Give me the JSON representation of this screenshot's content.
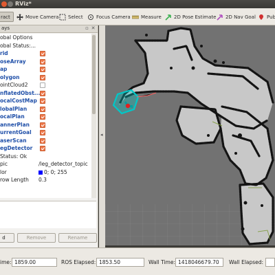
{
  "window": {
    "title": "RViz*"
  },
  "toolbar": {
    "interact": "ract",
    "move_camera": "Move Camera",
    "select": "Select",
    "focus_camera": "Focus Camera",
    "measure": "Measure",
    "pose_estimate": "2D Pose Estimate",
    "nav_goal": "2D Nav Goal",
    "publish": "Pub"
  },
  "displays": {
    "header": "ays",
    "items": [
      {
        "label": "obal Options",
        "style": "normal",
        "checked": null,
        "value": ""
      },
      {
        "label": "obal Status:...",
        "style": "normal",
        "checked": null,
        "value": ""
      },
      {
        "label": "rid",
        "style": "blue",
        "checked": true,
        "value": ""
      },
      {
        "label": "oseArray",
        "style": "blue",
        "checked": true,
        "value": ""
      },
      {
        "label": "ap",
        "style": "blue",
        "checked": true,
        "value": ""
      },
      {
        "label": "olygon",
        "style": "blue",
        "checked": true,
        "value": ""
      },
      {
        "label": "ointCloud2",
        "style": "normal",
        "checked": false,
        "value": ""
      },
      {
        "label": "nflatedObst...",
        "style": "blue",
        "checked": true,
        "value": ""
      },
      {
        "label": "ocalCostMap",
        "style": "blue",
        "checked": true,
        "value": ""
      },
      {
        "label": "lobalPlan",
        "style": "blue",
        "checked": true,
        "value": ""
      },
      {
        "label": "ocalPlan",
        "style": "blue",
        "checked": true,
        "value": ""
      },
      {
        "label": "annerPlan",
        "style": "blue",
        "checked": true,
        "value": ""
      },
      {
        "label": "urrentGoal",
        "style": "blue",
        "checked": true,
        "value": ""
      },
      {
        "label": "aserScan",
        "style": "blue",
        "checked": true,
        "value": ""
      },
      {
        "label": "egDetector",
        "style": "blue",
        "checked": true,
        "value": ""
      },
      {
        "label": "Status: Ok",
        "style": "normal",
        "checked": null,
        "value": ""
      },
      {
        "label": "pic",
        "style": "normal",
        "checked": null,
        "value": "/leg_detector_topic"
      },
      {
        "label": "lor",
        "style": "normal",
        "checked": null,
        "value": "0; 0; 255",
        "swatch": "#0000ff"
      },
      {
        "label": "row Length",
        "style": "normal",
        "checked": null,
        "value": "0.3"
      }
    ],
    "buttons": {
      "add": "d",
      "remove": "Remove",
      "rename": "Rename"
    }
  },
  "time": {
    "ros_time_label": "ime:",
    "ros_time": "1859.00",
    "ros_elapsed_label": "ROS Elapsed:",
    "ros_elapsed": "1853.50",
    "wall_time_label": "Wall Time:",
    "wall_time": "1418046679.70",
    "wall_elapsed_label": "Wall Elapsed:",
    "wall_elapsed": ""
  },
  "colors": {
    "map_free": "#c8c8c8",
    "map_unknown": "#727272",
    "obstacle": "#141414",
    "inflation": "#7e9b3a",
    "robot": "#00c8c8",
    "person_marker": "#e02020",
    "checkbox_on": "#f07a4c"
  }
}
